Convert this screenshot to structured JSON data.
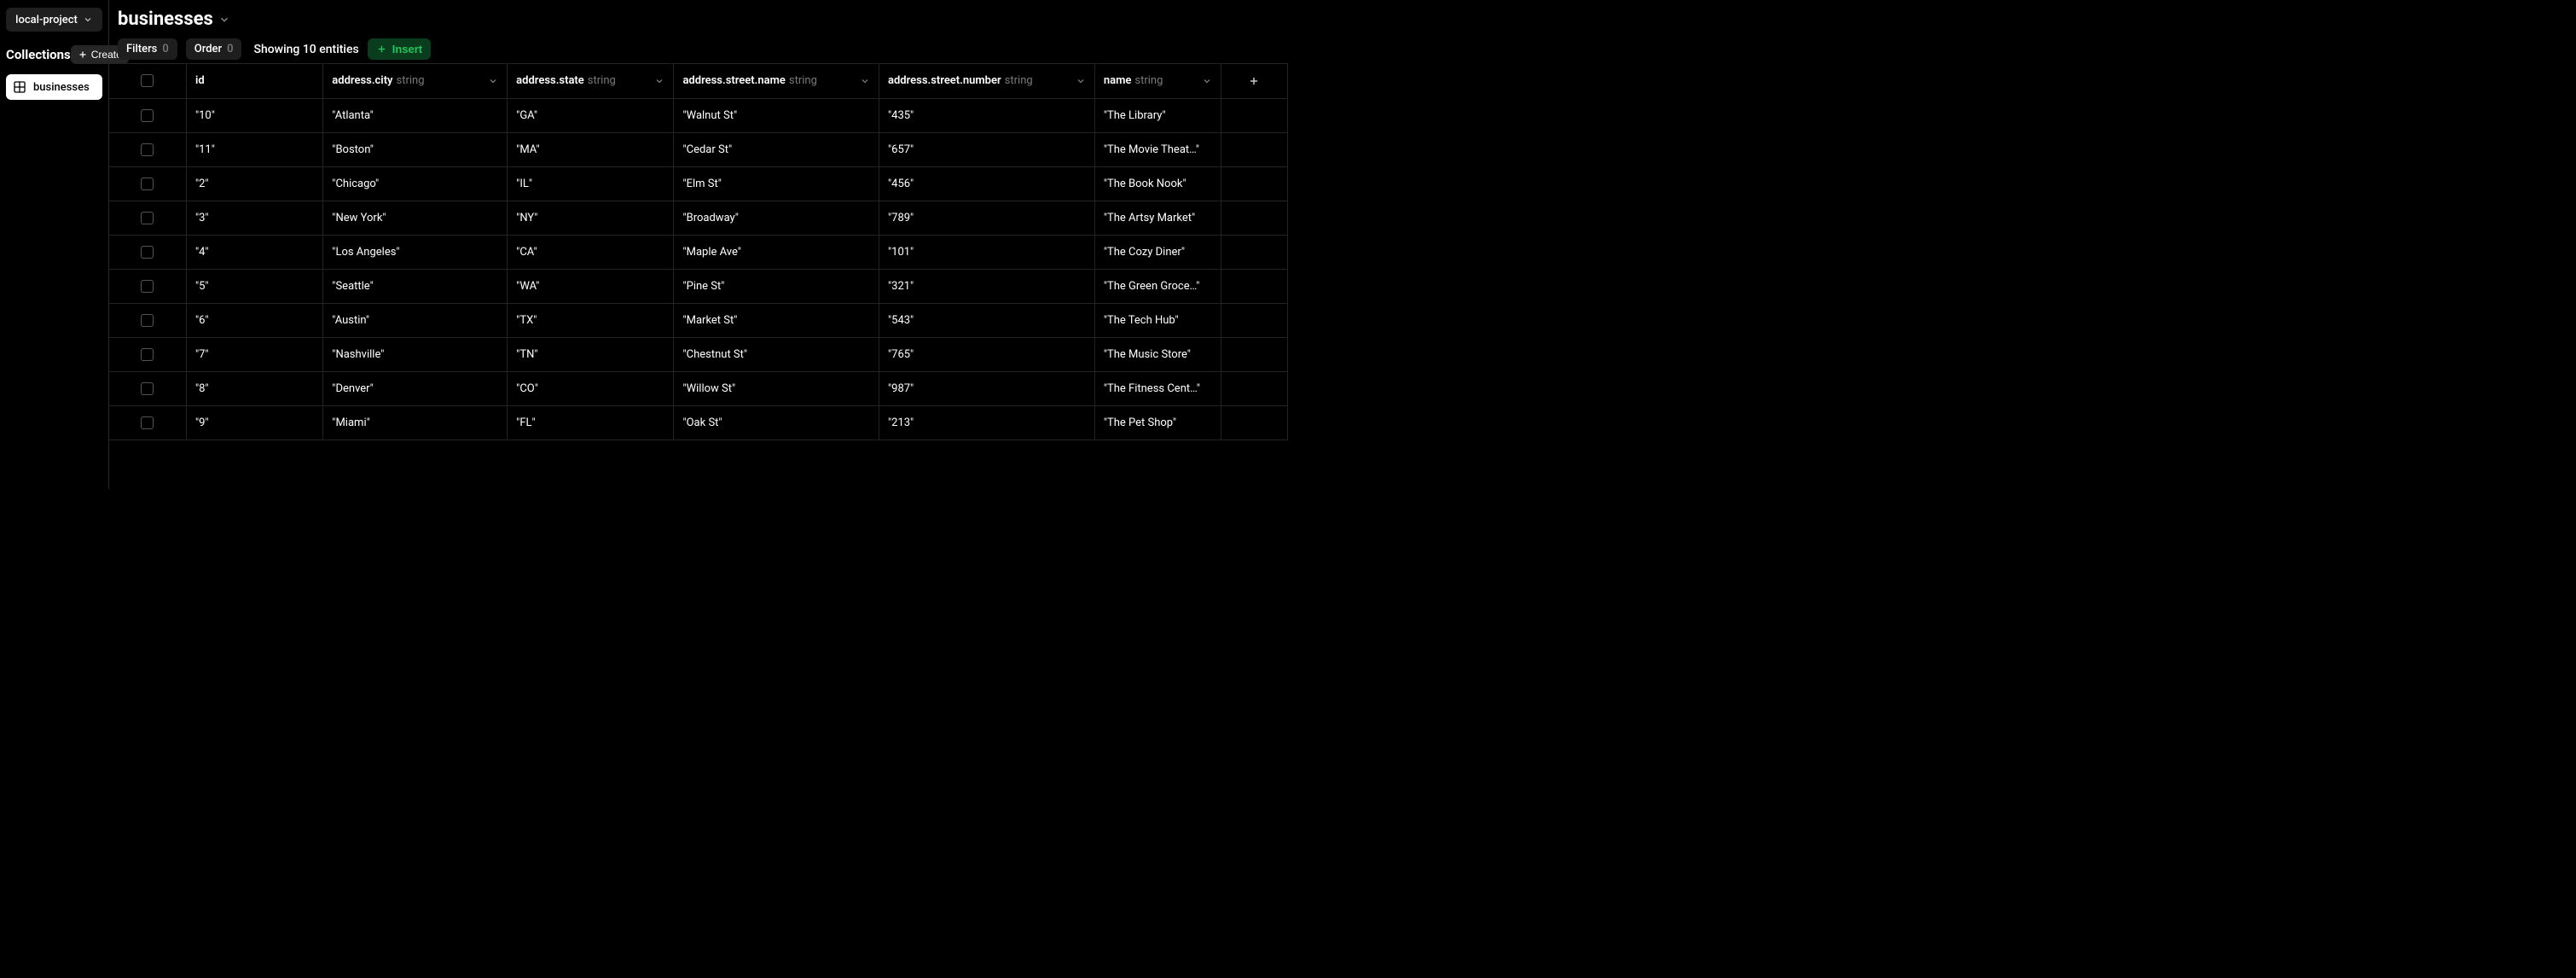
{
  "sidebar": {
    "project": "local-project",
    "collections_title": "Collections",
    "create_label": "Create",
    "items": [
      {
        "label": "businesses"
      }
    ]
  },
  "header": {
    "title": "businesses"
  },
  "toolbar": {
    "filters_label": "Filters",
    "filters_count": "0",
    "order_label": "Order",
    "order_count": "0",
    "showing": "Showing 10 entities",
    "insert_label": "Insert"
  },
  "table": {
    "columns": [
      {
        "name": "id",
        "type": ""
      },
      {
        "name": "address.city",
        "type": "string"
      },
      {
        "name": "address.state",
        "type": "string"
      },
      {
        "name": "address.street.name",
        "type": "string"
      },
      {
        "name": "address.street.number",
        "type": "string"
      },
      {
        "name": "name",
        "type": "string"
      }
    ],
    "rows": [
      {
        "id": "\"10\"",
        "city": "\"Atlanta\"",
        "state": "\"GA\"",
        "street_name": "\"Walnut St\"",
        "street_number": "\"435\"",
        "name": "\"The Library\""
      },
      {
        "id": "\"11\"",
        "city": "\"Boston\"",
        "state": "\"MA\"",
        "street_name": "\"Cedar St\"",
        "street_number": "\"657\"",
        "name": "\"The Movie Theat…\""
      },
      {
        "id": "\"2\"",
        "city": "\"Chicago\"",
        "state": "\"IL\"",
        "street_name": "\"Elm St\"",
        "street_number": "\"456\"",
        "name": "\"The Book Nook\""
      },
      {
        "id": "\"3\"",
        "city": "\"New York\"",
        "state": "\"NY\"",
        "street_name": "\"Broadway\"",
        "street_number": "\"789\"",
        "name": "\"The Artsy Market\""
      },
      {
        "id": "\"4\"",
        "city": "\"Los Angeles\"",
        "state": "\"CA\"",
        "street_name": "\"Maple Ave\"",
        "street_number": "\"101\"",
        "name": "\"The Cozy Diner\""
      },
      {
        "id": "\"5\"",
        "city": "\"Seattle\"",
        "state": "\"WA\"",
        "street_name": "\"Pine St\"",
        "street_number": "\"321\"",
        "name": "\"The Green Groce…\""
      },
      {
        "id": "\"6\"",
        "city": "\"Austin\"",
        "state": "\"TX\"",
        "street_name": "\"Market St\"",
        "street_number": "\"543\"",
        "name": "\"The Tech Hub\""
      },
      {
        "id": "\"7\"",
        "city": "\"Nashville\"",
        "state": "\"TN\"",
        "street_name": "\"Chestnut St\"",
        "street_number": "\"765\"",
        "name": "\"The Music Store\""
      },
      {
        "id": "\"8\"",
        "city": "\"Denver\"",
        "state": "\"CO\"",
        "street_name": "\"Willow St\"",
        "street_number": "\"987\"",
        "name": "\"The Fitness Cent…\""
      },
      {
        "id": "\"9\"",
        "city": "\"Miami\"",
        "state": "\"FL\"",
        "street_name": "\"Oak St\"",
        "street_number": "\"213\"",
        "name": "\"The Pet Shop\""
      }
    ]
  }
}
